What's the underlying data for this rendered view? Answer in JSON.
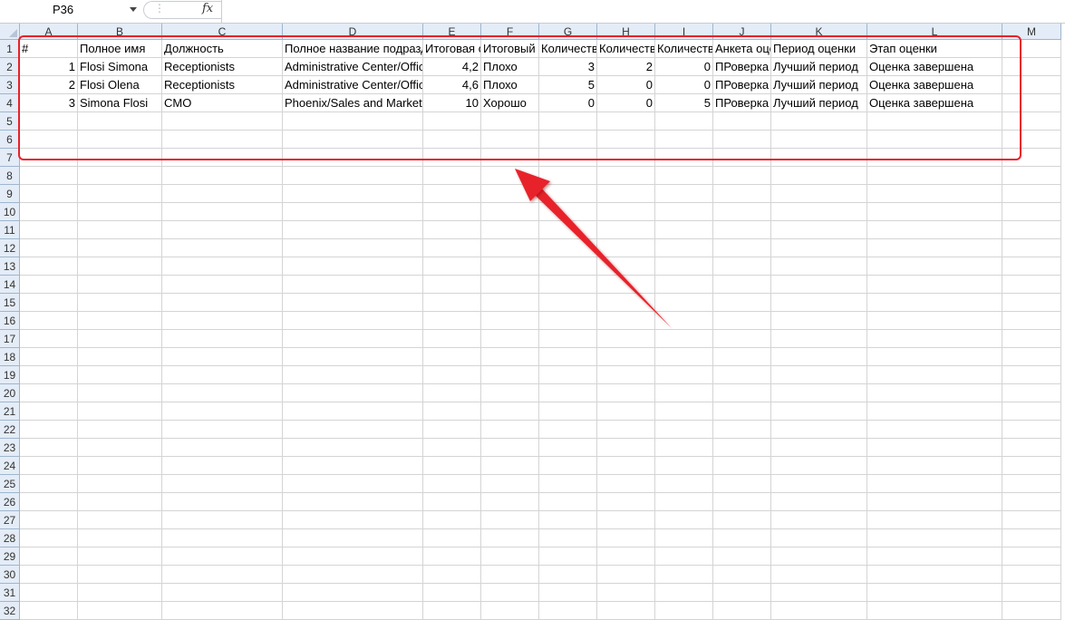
{
  "formula_bar": {
    "name_box": "P36",
    "fx_label": "fx",
    "formula_value": ""
  },
  "columns": [
    "A",
    "B",
    "C",
    "D",
    "E",
    "F",
    "G",
    "H",
    "I",
    "J",
    "K",
    "L",
    "M"
  ],
  "rows": [
    [
      "#",
      "Полное имя",
      "Должность",
      "Полное название подразделения",
      "Итоговая оценка",
      "Итоговый результат",
      "Количество",
      "Количество",
      "Количество",
      "Анкета оценки",
      "Период оценки",
      "Этап оценки",
      ""
    ],
    [
      "1",
      "Flosi Simona",
      "Receptionists",
      "Administrative Center/Office",
      "4,2",
      "Плохо",
      "3",
      "2",
      "0",
      "ПРоверка",
      "Лучший период",
      "Оценка завершена",
      ""
    ],
    [
      "2",
      "Flosi Olena",
      "Receptionists",
      "Administrative Center/Office",
      "4,6",
      "Плохо",
      "5",
      "0",
      "0",
      "ПРоверка",
      "Лучший период",
      "Оценка завершена",
      ""
    ],
    [
      "3",
      "Simona Flosi",
      "CMO",
      "Phoenix/Sales and Marketing",
      "10",
      "Хорошо",
      "0",
      "0",
      "5",
      "ПРоверка",
      "Лучший период",
      "Оценка завершена",
      ""
    ]
  ],
  "row_count": 32,
  "highlight_color": "#e8202a"
}
